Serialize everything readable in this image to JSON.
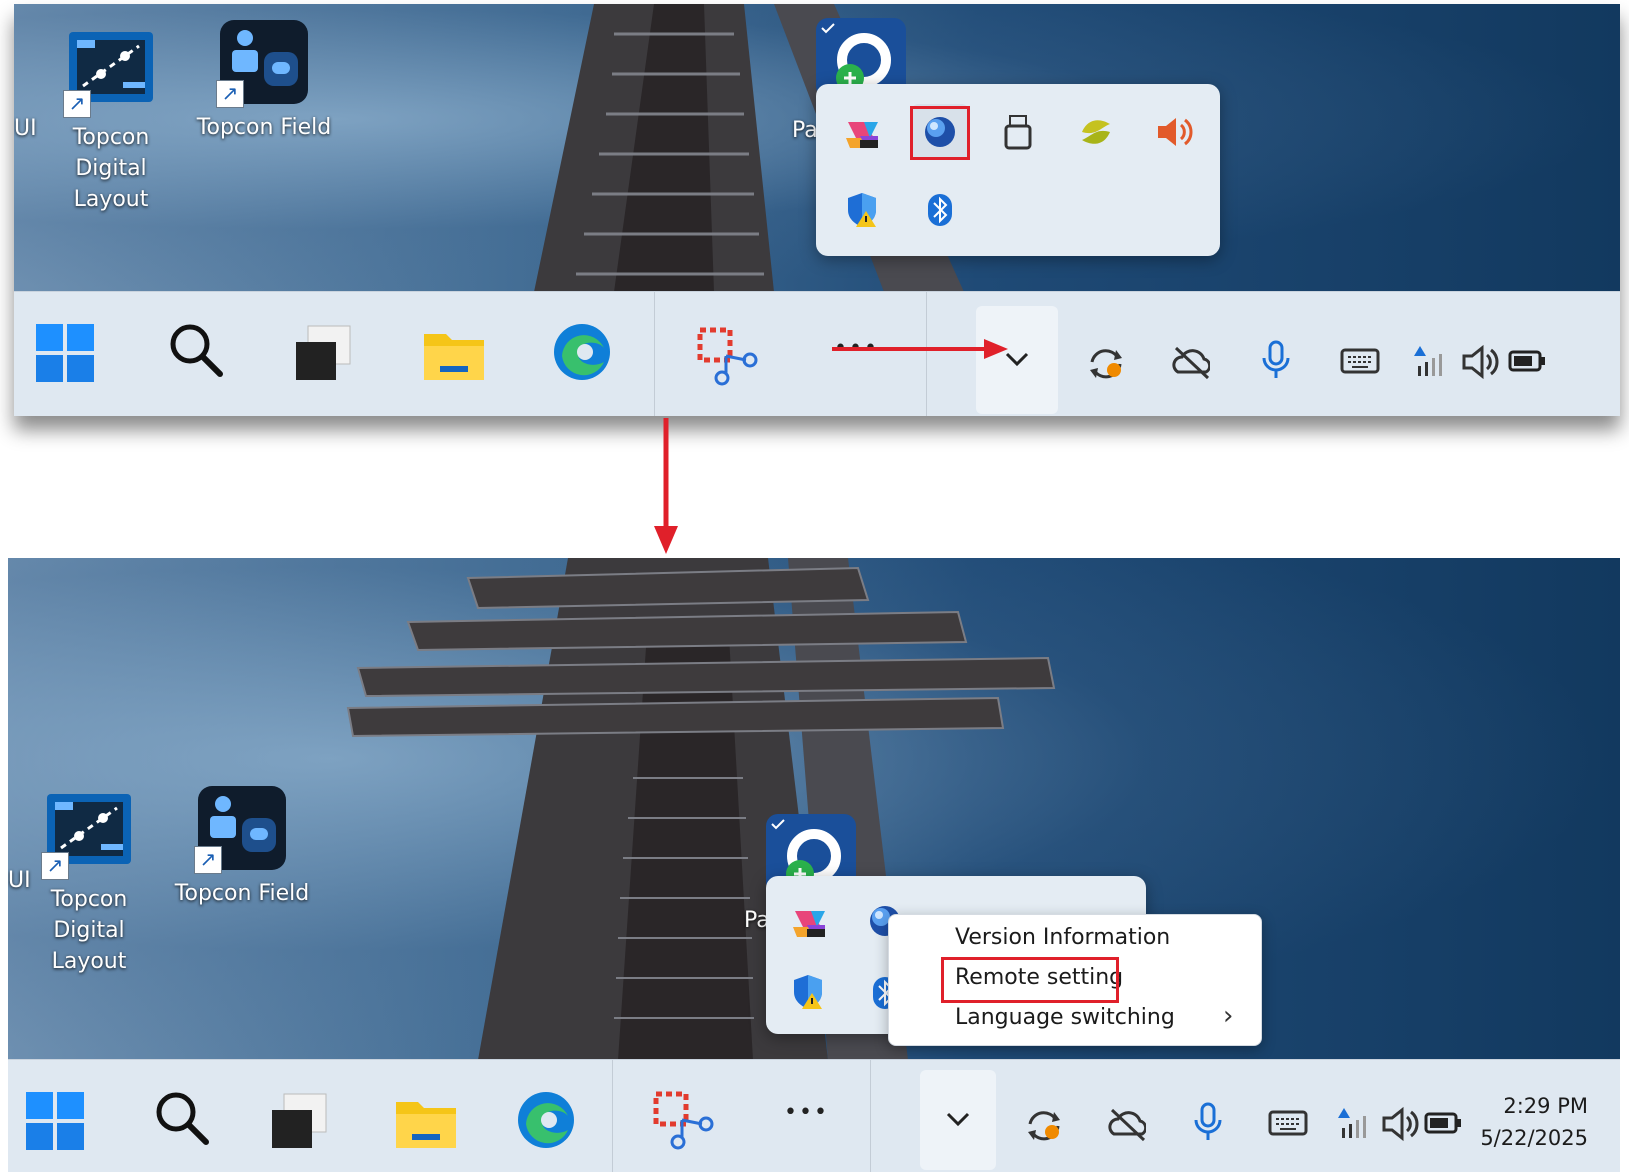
{
  "desktop": {
    "shortcuts": [
      {
        "label": "Topcon Digital Layout",
        "line1": "Topcon",
        "line2": "Digital Layout"
      },
      {
        "label": "Topcon Field"
      }
    ],
    "partial_left_label": "UI",
    "partial_pa_label": "Pa"
  },
  "taskbar": {
    "apps": [
      "start-icon",
      "search-icon",
      "task-view-icon",
      "file-explorer-icon",
      "edge-icon",
      "snipping-tool-icon",
      "more-icon"
    ],
    "overflow_glyph": "⌄",
    "more_glyph": "•••",
    "tray": [
      "sync-icon",
      "cloud-off-icon",
      "microphone-icon",
      "keyboard-icon",
      "network-icon",
      "volume-icon",
      "battery-icon"
    ]
  },
  "tray_flyout": {
    "icons": [
      "copilot-icon",
      "blue-orb-app-icon",
      "usb-device-icon",
      "pinwheel-app-icon",
      "speaker-icon",
      "defender-warning-icon",
      "bluetooth-icon"
    ]
  },
  "context_menu": {
    "items": [
      {
        "label": "Version Information"
      },
      {
        "label": "Remote setting"
      },
      {
        "label": "Language switching",
        "submenu_arrow": "›"
      }
    ]
  },
  "clock": {
    "time": "2:29 PM",
    "date": "5/22/2025"
  },
  "colors": {
    "annotation_red": "#e0202a",
    "taskbar_bg": "#dfe8f1",
    "accent_blue": "#0078d4"
  }
}
